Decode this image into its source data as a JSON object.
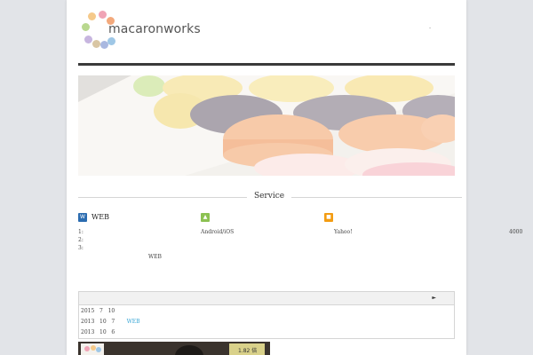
{
  "header": {
    "logo_text": "macaronworks",
    "top_link": "-"
  },
  "logo_dots": [
    "#f5c98a",
    "#f0a3b5",
    "#b9d88f",
    "#f3a97c",
    "#c7b5df",
    "#9fc7e6",
    "#d9c6a4",
    "#a9b8e0"
  ],
  "service": {
    "title": "Service",
    "columns": [
      {
        "icon": "web-icon",
        "icon_glyph": "W",
        "icon_color": "#2b6cb0",
        "name": "WEB",
        "lines": [
          "1:",
          "2:",
          "3:"
        ],
        "extra": "WEB"
      },
      {
        "icon": "android-icon",
        "icon_glyph": "▲",
        "icon_color": "#8cc152",
        "name": "",
        "lines": [
          "Android/iOS"
        ]
      },
      {
        "icon": "yahoo-icon",
        "icon_glyph": "■",
        "icon_color": "#f39c12",
        "name": "",
        "lines": [
          "Yahoo!"
        ],
        "right_value": "4000"
      }
    ]
  },
  "news": {
    "arrow": "►",
    "items": [
      {
        "year": "2015",
        "month": "7",
        "day": "10",
        "text": ""
      },
      {
        "year": "2013",
        "month": "10",
        "day": "7",
        "text": "WEB"
      },
      {
        "year": "2013",
        "month": "10",
        "day": "6",
        "text": ""
      }
    ]
  },
  "thumb_caption": "1.82 倍"
}
